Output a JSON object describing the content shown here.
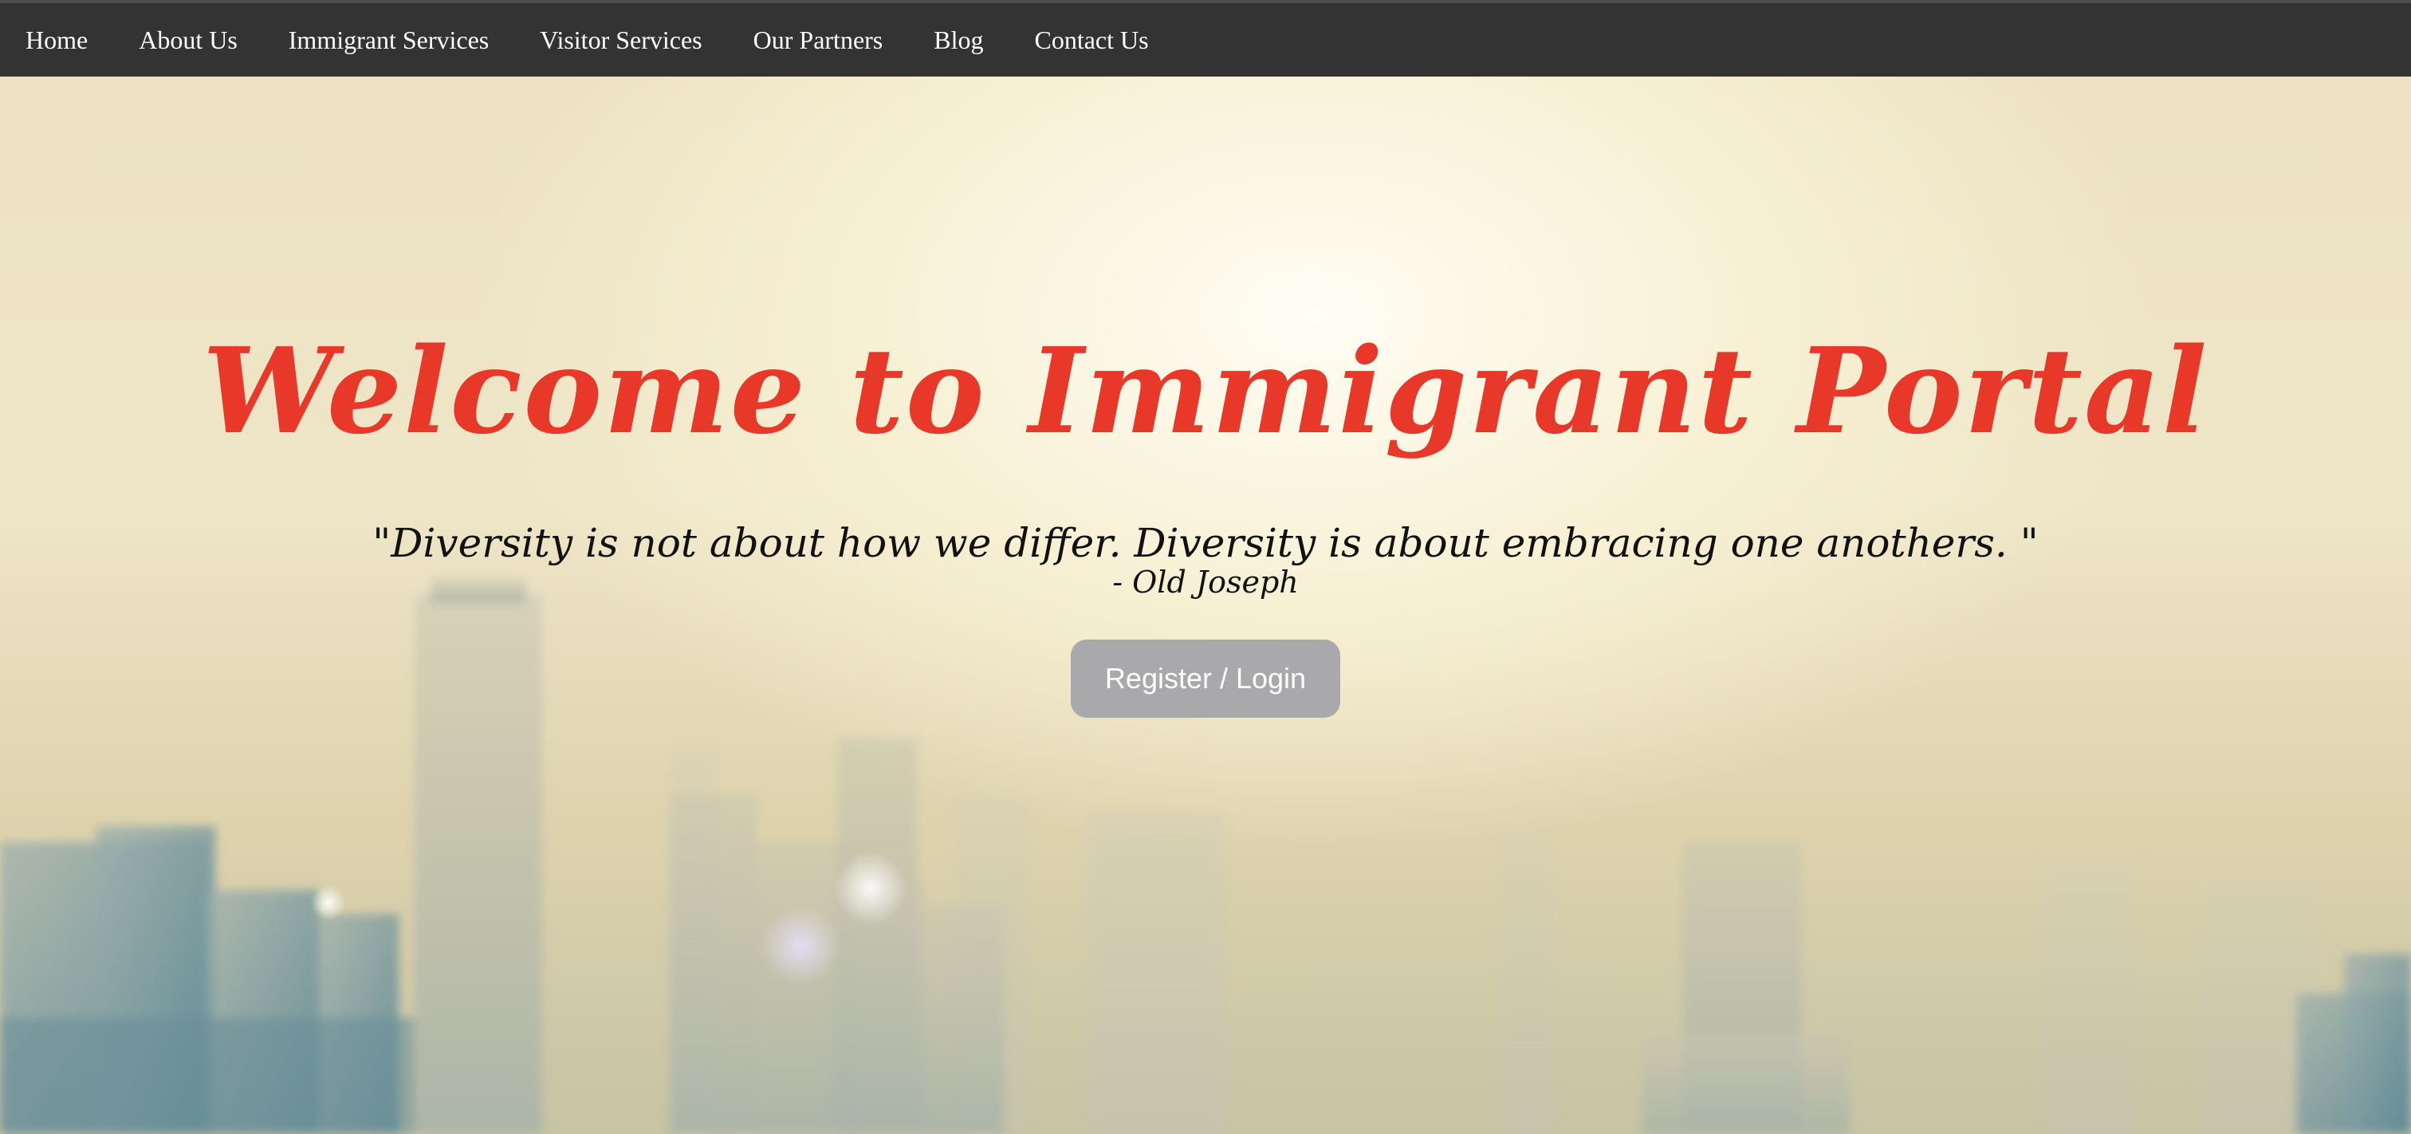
{
  "nav": {
    "items": [
      {
        "label": "Home"
      },
      {
        "label": "About Us"
      },
      {
        "label": "Immigrant Services"
      },
      {
        "label": "Visitor Services"
      },
      {
        "label": "Our Partners"
      },
      {
        "label": "Blog"
      },
      {
        "label": "Contact Us"
      }
    ]
  },
  "hero": {
    "title": "Welcome to Immigrant Portal",
    "quote": "\"Diversity is not about how we differ. Diversity is about embracing one anothers. \"",
    "author": "- Old Joseph",
    "button_label": "Register / Login"
  },
  "colors": {
    "navbar": "#333333",
    "title": "#e8382a",
    "button": "#a9a9ac"
  }
}
